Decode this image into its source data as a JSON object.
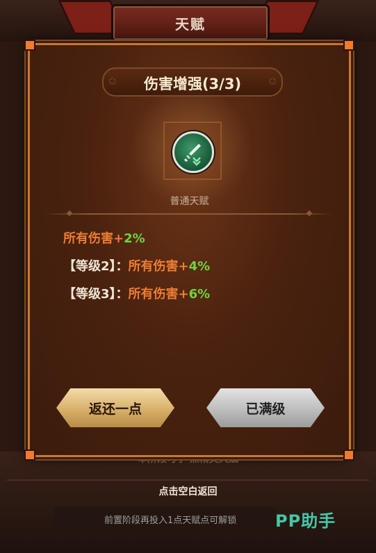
{
  "background": {
    "title": "天赋",
    "bottom_text": "本阶段可学  点精英天赋",
    "hint": "点击空白返回",
    "unlock_text": "前置阶段再投入1点天赋点可解锁",
    "watermark": "PP助手"
  },
  "modal": {
    "title": "伤害增强(3/3)",
    "icon": "sword-arrows-icon",
    "subtitle": "普通天赋",
    "effects": [
      {
        "prefix": "",
        "label": "所有伤害+",
        "value": "2%"
      },
      {
        "prefix": "【等级2】：",
        "label": "所有伤害+",
        "value": "4%"
      },
      {
        "prefix": "【等级3】：",
        "label": "所有伤害+",
        "value": "6%"
      }
    ],
    "buttons": {
      "return": "返还一点",
      "max": "已满级"
    }
  },
  "colors": {
    "accent_orange": "#ee7d32",
    "value_green": "#6fd43f",
    "frame": "#c9782e"
  }
}
